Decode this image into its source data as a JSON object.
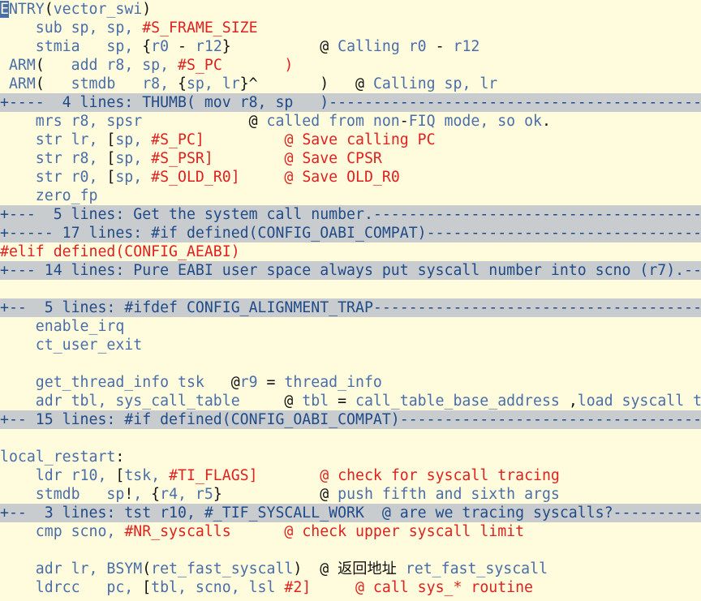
{
  "colors": {
    "background": "#fffbdd",
    "code": "#4a6ea9",
    "macro": "#e0211f",
    "punct": "#111111",
    "fold_bg": "#c9cccf",
    "fold_text": "#1f4b88",
    "cursor": "#4a6ea9"
  },
  "lines": [
    {
      "fold": false,
      "segs": [
        {
          "t": "E",
          "c": "cursor"
        },
        {
          "t": "NTRY",
          "c": "blue"
        },
        {
          "t": "(",
          "c": "black"
        },
        {
          "t": "vector_swi",
          "c": "blue"
        },
        {
          "t": ")",
          "c": "black"
        }
      ]
    },
    {
      "fold": false,
      "segs": [
        {
          "t": "    sub sp, sp, ",
          "c": "blue"
        },
        {
          "t": "#S_FRAME_SIZE",
          "c": "red"
        }
      ]
    },
    {
      "fold": false,
      "segs": [
        {
          "t": "    stmia   sp, ",
          "c": "blue"
        },
        {
          "t": "{",
          "c": "black"
        },
        {
          "t": "r0 ",
          "c": "blue"
        },
        {
          "t": "-",
          "c": "black"
        },
        {
          "t": " r12",
          "c": "blue"
        },
        {
          "t": "}",
          "c": "black"
        },
        {
          "t": "          ",
          "c": "blue"
        },
        {
          "t": "@",
          "c": "black"
        },
        {
          "t": " Calling r0 ",
          "c": "blue"
        },
        {
          "t": "-",
          "c": "black"
        },
        {
          "t": " r12",
          "c": "blue"
        }
      ]
    },
    {
      "fold": false,
      "segs": [
        {
          "t": " ARM",
          "c": "blue"
        },
        {
          "t": "(",
          "c": "black"
        },
        {
          "t": "   add r8, sp, ",
          "c": "blue"
        },
        {
          "t": "#S_PC",
          "c": "red"
        },
        {
          "t": "       ",
          "c": "blue"
        },
        {
          "t": ")",
          "c": "red"
        }
      ]
    },
    {
      "fold": false,
      "segs": [
        {
          "t": " ARM",
          "c": "blue"
        },
        {
          "t": "(",
          "c": "black"
        },
        {
          "t": "   stmdb   r8, ",
          "c": "blue"
        },
        {
          "t": "{",
          "c": "black"
        },
        {
          "t": "sp, lr",
          "c": "blue"
        },
        {
          "t": "}^",
          "c": "black"
        },
        {
          "t": "       ",
          "c": "blue"
        },
        {
          "t": ")",
          "c": "black"
        },
        {
          "t": "   ",
          "c": "blue"
        },
        {
          "t": "@",
          "c": "black"
        },
        {
          "t": " Calling sp, lr",
          "c": "blue"
        }
      ]
    },
    {
      "fold": true,
      "text": "+----  4 lines: THUMB( mov r8, sp   )------------------------------------------------"
    },
    {
      "fold": false,
      "segs": [
        {
          "t": "    mrs r8, spsr            ",
          "c": "blue"
        },
        {
          "t": "@",
          "c": "black"
        },
        {
          "t": " called from non",
          "c": "blue"
        },
        {
          "t": "-",
          "c": "black"
        },
        {
          "t": "FIQ mode, so ok",
          "c": "blue"
        },
        {
          "t": ".",
          "c": "black"
        }
      ]
    },
    {
      "fold": false,
      "segs": [
        {
          "t": "    str lr, ",
          "c": "blue"
        },
        {
          "t": "[",
          "c": "black"
        },
        {
          "t": "sp, ",
          "c": "blue"
        },
        {
          "t": "#S_PC]",
          "c": "red"
        },
        {
          "t": "         ",
          "c": "blue"
        },
        {
          "t": "@ Save calling PC",
          "c": "red"
        }
      ]
    },
    {
      "fold": false,
      "segs": [
        {
          "t": "    str r8, ",
          "c": "blue"
        },
        {
          "t": "[",
          "c": "black"
        },
        {
          "t": "sp, ",
          "c": "blue"
        },
        {
          "t": "#S_PSR]",
          "c": "red"
        },
        {
          "t": "        ",
          "c": "blue"
        },
        {
          "t": "@ Save CPSR",
          "c": "red"
        }
      ]
    },
    {
      "fold": false,
      "segs": [
        {
          "t": "    str r0, ",
          "c": "blue"
        },
        {
          "t": "[",
          "c": "black"
        },
        {
          "t": "sp, ",
          "c": "blue"
        },
        {
          "t": "#S_OLD_R0]",
          "c": "red"
        },
        {
          "t": "     ",
          "c": "blue"
        },
        {
          "t": "@ Save OLD_R0",
          "c": "red"
        }
      ]
    },
    {
      "fold": false,
      "segs": [
        {
          "t": "    zero_fp",
          "c": "blue"
        }
      ]
    },
    {
      "fold": true,
      "text": "+---  5 lines: Get the system call number.-----------------------------------------------"
    },
    {
      "fold": true,
      "text": "+----- 17 lines: #if defined(CONFIG_OABI_COMPAT)-----------------------------------------"
    },
    {
      "fold": false,
      "segs": [
        {
          "t": "#elif defined(CONFIG_AEABI)",
          "c": "red"
        }
      ]
    },
    {
      "fold": true,
      "text": "+--- 14 lines: Pure EABI user space always put syscall number into scno (r7).-----------"
    },
    {
      "fold": false,
      "segs": [
        {
          "t": "",
          "c": "blue"
        }
      ]
    },
    {
      "fold": true,
      "text": "+--  5 lines: #ifdef CONFIG_ALIGNMENT_TRAP------------------------------------------------"
    },
    {
      "fold": false,
      "segs": [
        {
          "t": "    enable_irq",
          "c": "blue"
        }
      ]
    },
    {
      "fold": false,
      "segs": [
        {
          "t": "    ct_user_exit",
          "c": "blue"
        }
      ]
    },
    {
      "fold": false,
      "segs": [
        {
          "t": "",
          "c": "blue"
        }
      ]
    },
    {
      "fold": false,
      "segs": [
        {
          "t": "    get_thread_info tsk   ",
          "c": "blue"
        },
        {
          "t": "@",
          "c": "black"
        },
        {
          "t": "r9 ",
          "c": "blue"
        },
        {
          "t": "=",
          "c": "black"
        },
        {
          "t": " thread_info",
          "c": "blue"
        }
      ]
    },
    {
      "fold": false,
      "segs": [
        {
          "t": "    adr tbl, sys_call_table     ",
          "c": "blue"
        },
        {
          "t": "@",
          "c": "black"
        },
        {
          "t": " tbl ",
          "c": "blue"
        },
        {
          "t": "=",
          "c": "black"
        },
        {
          "t": " call_table_base_address ",
          "c": "blue"
        },
        {
          "t": ",",
          "c": "black"
        },
        {
          "t": "load syscall table",
          "c": "blue"
        }
      ]
    },
    {
      "fold": true,
      "text": "+-- 15 lines: #if defined(CONFIG_OABI_COMPAT)---------------------------------------------"
    },
    {
      "fold": false,
      "segs": [
        {
          "t": "",
          "c": "blue"
        }
      ]
    },
    {
      "fold": false,
      "segs": [
        {
          "t": "local_restart",
          "c": "blue"
        },
        {
          "t": ":",
          "c": "black"
        }
      ]
    },
    {
      "fold": false,
      "segs": [
        {
          "t": "    ldr r10, ",
          "c": "blue"
        },
        {
          "t": "[",
          "c": "black"
        },
        {
          "t": "tsk, ",
          "c": "blue"
        },
        {
          "t": "#TI_FLAGS]",
          "c": "red"
        },
        {
          "t": "       ",
          "c": "blue"
        },
        {
          "t": "@ check for syscall tracing",
          "c": "red"
        }
      ]
    },
    {
      "fold": false,
      "segs": [
        {
          "t": "    stmdb   sp",
          "c": "blue"
        },
        {
          "t": "!",
          "c": "black"
        },
        {
          "t": ", ",
          "c": "blue"
        },
        {
          "t": "{",
          "c": "black"
        },
        {
          "t": "r4, r5",
          "c": "blue"
        },
        {
          "t": "}",
          "c": "black"
        },
        {
          "t": "           ",
          "c": "blue"
        },
        {
          "t": "@",
          "c": "black"
        },
        {
          "t": " push fifth and sixth args",
          "c": "blue"
        }
      ]
    },
    {
      "fold": true,
      "text": "+--  3 lines: tst r10, #_TIF_SYSCALL_WORK  @ are we tracing syscalls?--------------------"
    },
    {
      "fold": false,
      "segs": [
        {
          "t": "    cmp scno, ",
          "c": "blue"
        },
        {
          "t": "#NR_syscalls",
          "c": "red"
        },
        {
          "t": "      ",
          "c": "blue"
        },
        {
          "t": "@ check upper syscall limit",
          "c": "red"
        }
      ]
    },
    {
      "fold": false,
      "segs": [
        {
          "t": "",
          "c": "blue"
        }
      ]
    },
    {
      "fold": false,
      "segs": [
        {
          "t": "    adr lr, BSYM",
          "c": "blue"
        },
        {
          "t": "(",
          "c": "black"
        },
        {
          "t": "ret_fast_syscall",
          "c": "blue"
        },
        {
          "t": ")",
          "c": "black"
        },
        {
          "t": "  ",
          "c": "blue"
        },
        {
          "t": "@ 返回地址",
          "c": "black"
        },
        {
          "t": " ret_fast_syscall",
          "c": "blue"
        }
      ]
    },
    {
      "fold": false,
      "segs": [
        {
          "t": "    ldrcc   pc, ",
          "c": "blue"
        },
        {
          "t": "[",
          "c": "black"
        },
        {
          "t": "tbl, scno, lsl ",
          "c": "blue"
        },
        {
          "t": "#2]",
          "c": "red"
        },
        {
          "t": "     ",
          "c": "blue"
        },
        {
          "t": "@ call sys_* routine",
          "c": "red"
        }
      ]
    }
  ]
}
